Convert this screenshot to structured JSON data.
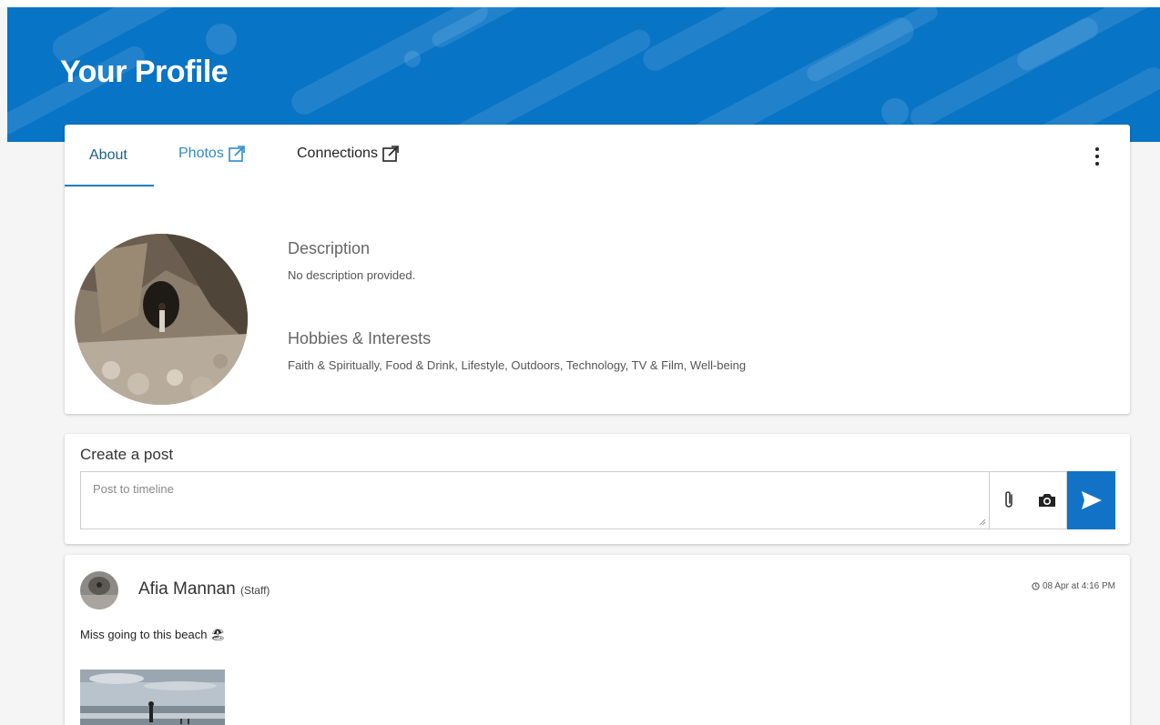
{
  "header": {
    "title": "Your Profile"
  },
  "tabs": [
    {
      "label": "About",
      "active": true
    },
    {
      "label": "Photos",
      "icon": "external-link-icon"
    },
    {
      "label": "Connections",
      "icon": "external-link-icon"
    }
  ],
  "profile": {
    "description_title": "Description",
    "description_text": "No description provided.",
    "hobbies_title": "Hobbies & Interests",
    "hobbies_text": "Faith & Spiritually, Food & Drink, Lifestyle, Outdoors, Technology, TV & Film, Well-being"
  },
  "create_post": {
    "heading": "Create a post",
    "placeholder": "Post to timeline",
    "attach_icon": "paperclip-icon",
    "camera_icon": "camera-icon",
    "send_icon": "send-icon"
  },
  "feed": {
    "posts": [
      {
        "author": "Afia Mannan",
        "role": "(Staff)",
        "timestamp": "08 Apr at 4:16 PM",
        "text": "Miss going to this beach 🏖"
      }
    ]
  },
  "colors": {
    "brand": "#0874c6",
    "send_button": "#1273c6",
    "active_tab": "#1a5f8e",
    "link_tab": "#2e8bc9"
  }
}
